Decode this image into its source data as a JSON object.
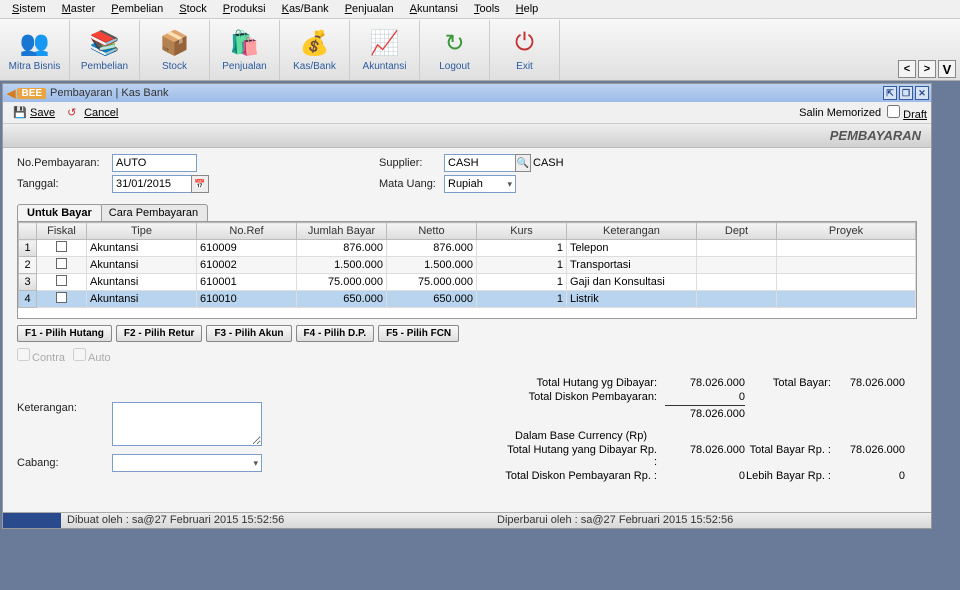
{
  "menu": [
    "Sistem",
    "Master",
    "Pembelian",
    "Stock",
    "Produksi",
    "Kas/Bank",
    "Penjualan",
    "Akuntansi",
    "Tools",
    "Help"
  ],
  "menu_ul": [
    "S",
    "M",
    "P",
    "S",
    "P",
    "K",
    "P",
    "A",
    "T",
    "H"
  ],
  "toolbar": [
    {
      "label": "Mitra Bisnis",
      "icon": "👥",
      "color": "#d97a1a"
    },
    {
      "label": "Pembelian",
      "icon": "📚",
      "color": "#c04040"
    },
    {
      "label": "Stock",
      "icon": "📦",
      "color": "#d9a040"
    },
    {
      "label": "Penjualan",
      "icon": "🛍️",
      "color": "#2a4a9e"
    },
    {
      "label": "Kas/Bank",
      "icon": "💰",
      "color": "#c08030"
    },
    {
      "label": "Akuntansi",
      "icon": "📈",
      "color": "#3a9a3a"
    },
    {
      "label": "Logout",
      "icon": "↻",
      "color": "#3a9a3a"
    },
    {
      "label": "Exit",
      "icon": "⏻",
      "color": "#c03030"
    }
  ],
  "right_btns": [
    "<",
    ">",
    "V"
  ],
  "window": {
    "title": "Pembayaran | Kas Bank",
    "bee": "BEE",
    "save": "Save",
    "cancel": "Cancel",
    "salin": "Salin Memorized",
    "draft": "Draft",
    "banner": "PEMBAYARAN"
  },
  "form": {
    "no_label": "No.Pembayaran:",
    "no_value": "AUTO",
    "tgl_label": "Tanggal:",
    "tgl_value": "31/01/2015",
    "sup_label": "Supplier:",
    "sup_value": "CASH",
    "sup_name": "CASH",
    "cur_label": "Mata Uang:",
    "cur_value": "Rupiah"
  },
  "tabs": [
    "Untuk Bayar",
    "Cara Pembayaran"
  ],
  "cols": [
    "Fiskal",
    "Tipe",
    "No.Ref",
    "Jumlah Bayar",
    "Netto",
    "Kurs",
    "Keterangan",
    "Dept",
    "Proyek"
  ],
  "rows": [
    {
      "n": "1",
      "tipe": "Akuntansi",
      "ref": "610009",
      "jml": "876.000",
      "net": "876.000",
      "kurs": "1",
      "ket": "Telepon"
    },
    {
      "n": "2",
      "tipe": "Akuntansi",
      "ref": "610002",
      "jml": "1.500.000",
      "net": "1.500.000",
      "kurs": "1",
      "ket": "Transportasi"
    },
    {
      "n": "3",
      "tipe": "Akuntansi",
      "ref": "610001",
      "jml": "75.000.000",
      "net": "75.000.000",
      "kurs": "1",
      "ket": "Gaji dan Konsultasi"
    },
    {
      "n": "4",
      "tipe": "Akuntansi",
      "ref": "610010",
      "jml": "650.000",
      "net": "650.000",
      "kurs": "1",
      "ket": "Listrik"
    }
  ],
  "fkeys": [
    "F1 - Pilih Hutang",
    "F2 - Pilih Retur",
    "F3 - Pilih Akun",
    "F4 - Pilih D.P.",
    "F5 - Pilih FCN"
  ],
  "checks": [
    "Contra",
    "Auto"
  ],
  "totals": {
    "l1": "Total Hutang yg Dibayar:",
    "v1": "78.026.000",
    "rl1": "Total Bayar:",
    "rv1": "78.026.000",
    "l2": "Total Diskon Pembayaran:",
    "v2": "0",
    "v3": "78.026.000",
    "base": "Dalam Base Currency (Rp)",
    "l4": "Total Hutang yang Dibayar Rp. :",
    "v4": "78.026.000",
    "rl4": "Total Bayar Rp. :",
    "rv4": "78.026.000",
    "l5": "Total Diskon Pembayaran Rp. :",
    "v5": "0",
    "rl5": "Lebih Bayar Rp. :",
    "rv5": "0"
  },
  "bottom": {
    "ket_label": "Keterangan:",
    "cab_label": "Cabang:"
  },
  "status": {
    "created": "Dibuat oleh : sa@27 Februari 2015  15:52:56",
    "updated": "Diperbarui oleh : sa@27 Februari 2015  15:52:56"
  }
}
